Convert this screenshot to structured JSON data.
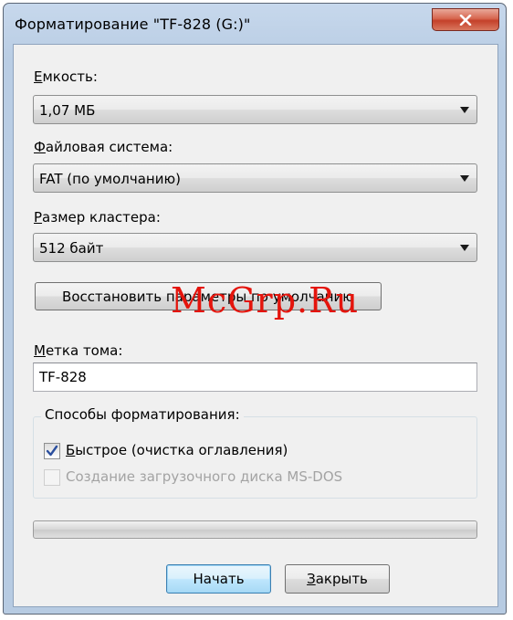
{
  "window": {
    "title": "Форматирование \"TF-828 (G:)\""
  },
  "capacity": {
    "label_accel": "Е",
    "label_rest": "мкость:",
    "value": "1,07 МБ"
  },
  "filesystem": {
    "label_accel": "Ф",
    "label_rest": "айловая система:",
    "value": "FAT (по умолчанию)"
  },
  "cluster": {
    "label_accel": "Р",
    "label_rest": "азмер кластера:",
    "value": "512 байт"
  },
  "restore_defaults_label": "Восстановить параметры по умолчанию",
  "volume": {
    "label_accel": "М",
    "label_rest": "етка тома:",
    "value": "TF-828"
  },
  "format_options": {
    "title": "Способы форматирования:",
    "quick": {
      "label_accel": "Б",
      "label_rest": "ыстрое (очистка оглавления)",
      "checked": true
    },
    "msdos": {
      "label": "Создание загрузочного диска MS-DOS",
      "checked": false,
      "enabled": false
    }
  },
  "progress": {
    "fraction": 0
  },
  "buttons": {
    "start_label": "Начать",
    "close_accel": "З",
    "close_rest": "акрыть"
  },
  "watermark": "McGrp.Ru",
  "colors": {
    "watermark": "#e4140c",
    "close_button": "#c4402a",
    "default_button_border": "#3c7fb1"
  }
}
